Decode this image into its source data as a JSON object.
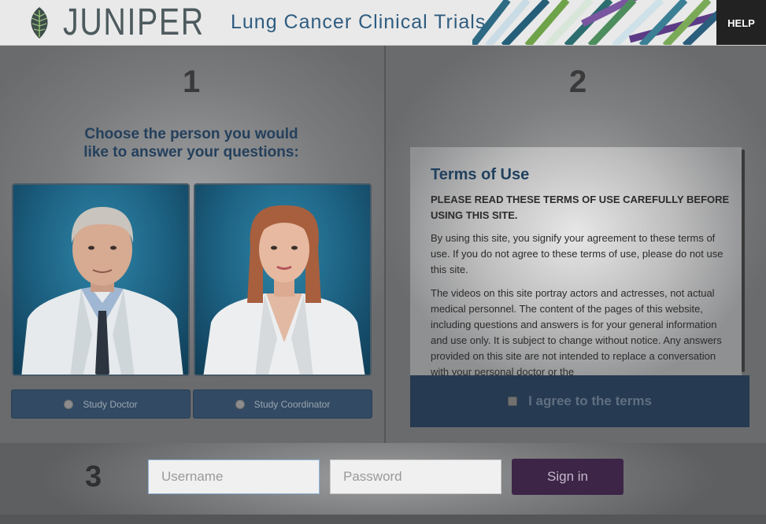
{
  "header": {
    "logo_text": "JUNIPER",
    "title": "Lung Cancer Clinical Trials",
    "help_label": "HELP"
  },
  "step1": {
    "number": "1",
    "heading_line1": "Choose the person you would",
    "heading_line2": "like to answer your questions:",
    "options": [
      {
        "label": "Study Doctor"
      },
      {
        "label": "Study Coordinator"
      }
    ]
  },
  "step2": {
    "number": "2",
    "terms_title": "Terms of Use",
    "terms_warning": "PLEASE READ THESE TERMS OF USE CAREFULLY BEFORE USING THIS SITE.",
    "terms_paragraphs": [
      "By using this site, you signify your agreement to these terms of use. If you do not agree to these terms of use, please do not use this site.",
      "The videos on this site portray actors and actresses, not actual medical personnel. The content of the pages of this website, including questions and answers is for your general information and use only. It is subject to change without notice. Any answers provided on this site are not intended to replace a conversation with your personal doctor or the"
    ],
    "agree_label": "I agree to the terms"
  },
  "step3": {
    "number": "3",
    "username_placeholder": "Username",
    "password_placeholder": "Password",
    "signin_label": "Sign in"
  },
  "colors": {
    "title_blue": "#2f5c80",
    "signin_purple": "#3d2548",
    "agree_bar": "#263a52"
  }
}
